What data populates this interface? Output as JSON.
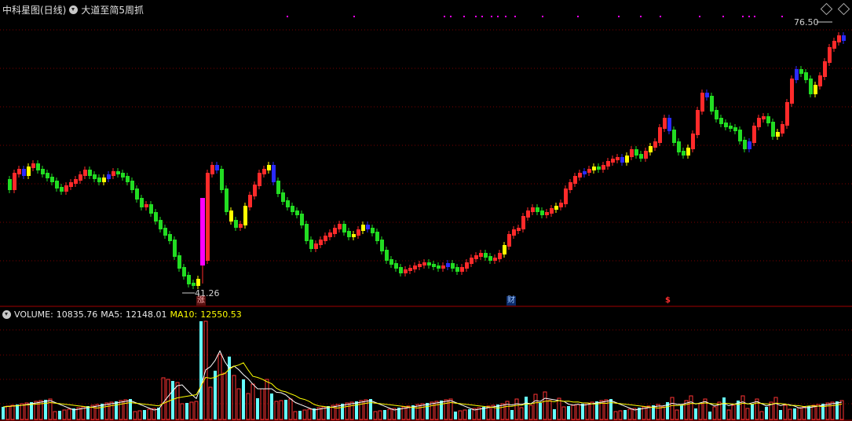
{
  "header": {
    "title": "中科星图(日线)",
    "indicator": "大道至简5周抓",
    "title_color": "#e0e0e0"
  },
  "price_panel": {
    "high_label": "76.50",
    "low_label": "41.26",
    "markers": {
      "zhang": "涨",
      "cai": "财",
      "dollar": "$"
    }
  },
  "volume_panel": {
    "volume_label": "VOLUME:",
    "volume_value": "10835.76",
    "ma5_label": "MA5:",
    "ma5_value": "12148.01",
    "ma10_label": "MA10:",
    "ma10_value": "12550.53"
  },
  "colors": {
    "up": "#ff2a2a",
    "down": "#22dd22",
    "yellow": "#ffff00",
    "blue": "#2a2aff",
    "magenta": "#ff00ff",
    "vol_up": "#ff3333",
    "vol_down": "#66ffff",
    "grid": "#7a0000",
    "ma5": "#ffffff",
    "ma10": "#ffff00"
  }
}
